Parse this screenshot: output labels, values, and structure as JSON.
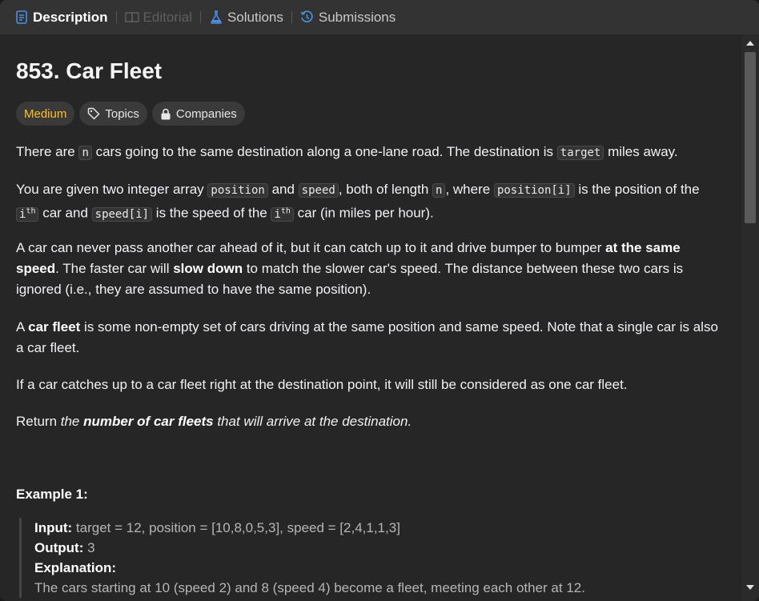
{
  "tabs": [
    {
      "label": "Description",
      "icon": "document-icon",
      "state": "active"
    },
    {
      "label": "Editorial",
      "icon": "book-icon",
      "state": "disabled"
    },
    {
      "label": "Solutions",
      "icon": "flask-icon",
      "state": "normal"
    },
    {
      "label": "Submissions",
      "icon": "history-icon",
      "state": "normal"
    }
  ],
  "problem": {
    "title": "853. Car Fleet",
    "difficulty": "Medium",
    "topics_label": "Topics",
    "companies_label": "Companies"
  },
  "description": {
    "p1": {
      "a": "There are ",
      "code_n": "n",
      "b": " cars going to the same destination along a one-lane road. The destination is ",
      "code_target": "target",
      "c": " miles away."
    },
    "p2": {
      "a": "You are given two integer array ",
      "code_position": "position",
      "b": " and ",
      "code_speed": "speed",
      "c": ", both of length ",
      "code_n": "n",
      "d": ", where ",
      "code_position_i": "position[i]",
      "e": " is the position of the ",
      "i1": "i",
      "th1": "th",
      "f": " car and ",
      "code_speed_i": "speed[i]",
      "g": " is the speed of the ",
      "i2": "i",
      "th2": "th",
      "h": " car (in miles per hour)."
    },
    "p3": {
      "a": "A car can never pass another car ahead of it, but it can catch up to it and drive bumper to bumper ",
      "bold1": "at the same speed",
      "b": ". The faster car will ",
      "bold2": "slow down",
      "c": " to match the slower car's speed. The distance between these two cars is ignored (i.e., they are assumed to have the same position)."
    },
    "p4": {
      "a": "A ",
      "bold": "car fleet",
      "b": " is some non-empty set of cars driving at the same position and same speed. Note that a single car is also a car fleet."
    },
    "p5": "If a car catches up to a car fleet right at the destination point, it will still be considered as one car fleet.",
    "p6": {
      "a": "Return ",
      "i1": "the ",
      "bold": "number of car fleets",
      "i2": " that will arrive at the destination."
    }
  },
  "example1": {
    "title": "Example 1:",
    "input_label": "Input:",
    "input_value": " target = 12, position = [10,8,0,5,3], speed = [2,4,1,1,3]",
    "output_label": "Output:",
    "output_value": " 3",
    "explanation_label": "Explanation:",
    "explanation_line": "The cars starting at 10 (speed 2) and 8 (speed 4) become a fleet, meeting each other at 12."
  },
  "colors": {
    "medium": "#ffc01e",
    "background": "#262626",
    "tabbar": "#333333"
  }
}
